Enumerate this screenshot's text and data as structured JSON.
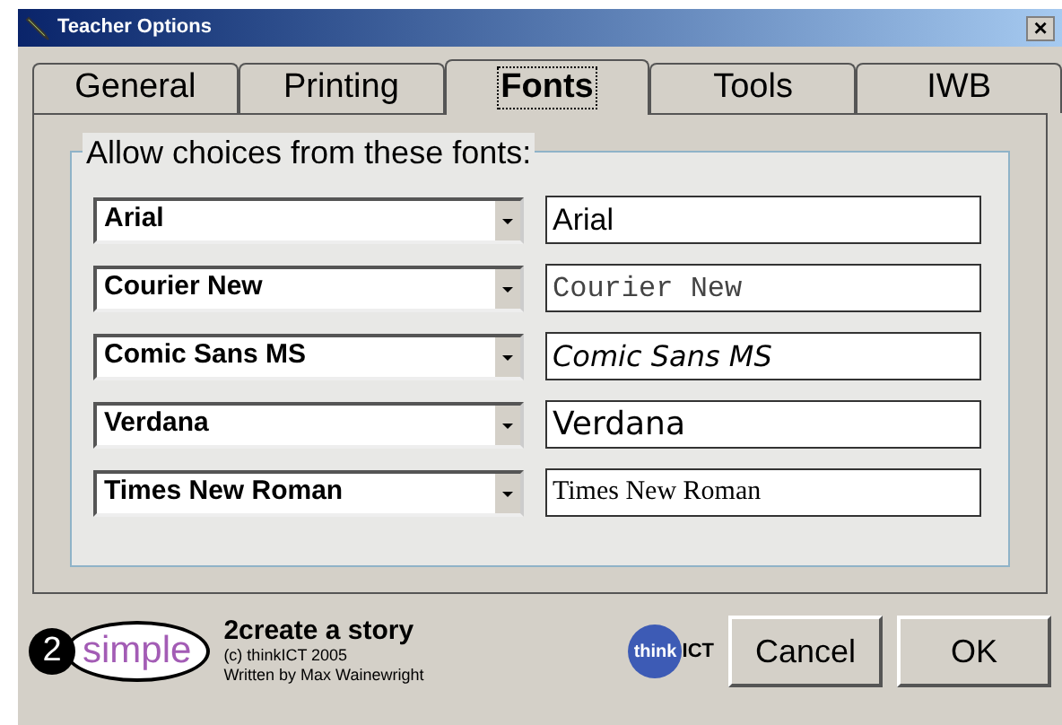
{
  "window": {
    "title": "Teacher Options",
    "close": "×"
  },
  "tabs": [
    {
      "label": "General",
      "selected": false
    },
    {
      "label": "Printing",
      "selected": false
    },
    {
      "label": "Fonts",
      "selected": true
    },
    {
      "label": "Tools",
      "selected": false
    },
    {
      "label": "IWB",
      "selected": false
    }
  ],
  "group": {
    "title": "Allow choices from these fonts:"
  },
  "fonts": [
    {
      "value": "Arial",
      "preview": "Arial",
      "kind": "sans"
    },
    {
      "value": "Courier New",
      "preview": "Courier New",
      "kind": "mono"
    },
    {
      "value": "Comic Sans MS",
      "preview": "Comic Sans MS",
      "kind": "comic"
    },
    {
      "value": "Verdana",
      "preview": "Verdana",
      "kind": "verdana"
    },
    {
      "value": "Times New Roman",
      "preview": "Times New Roman",
      "kind": "serif"
    }
  ],
  "footer": {
    "logo_number": "2",
    "logo_word": "simple",
    "product": "2create a story",
    "copyright": "(c) thinkICT 2005",
    "author": "Written by Max Wainewright",
    "partner_a": "think",
    "partner_b": "ICT"
  },
  "buttons": [
    "Cancel",
    "OK"
  ]
}
